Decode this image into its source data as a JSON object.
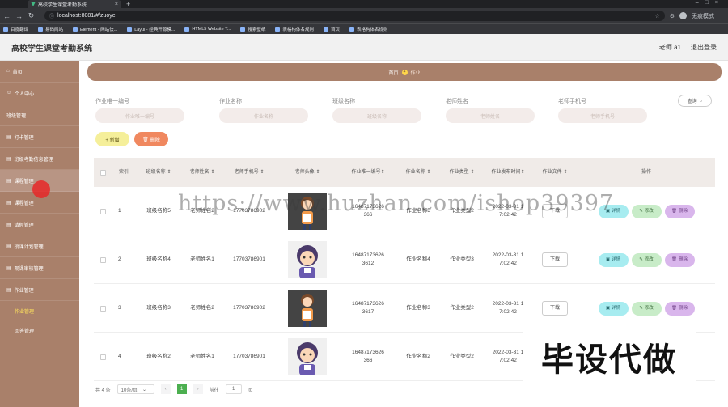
{
  "browser": {
    "tab_title": "高校学生课堂考勤系统",
    "url": "localhost:8081/#/zuoye",
    "profile_label": "无痕模式",
    "bookmarks": [
      "百度翻译",
      "易码网站",
      "Element - 网站快...",
      "Layui - 经典开源模...",
      "HTML5 Website T...",
      "搜索壁纸",
      "表格构体名规则",
      "首页",
      "表格构体名规则"
    ]
  },
  "app": {
    "title": "高校学生课堂考勤系统",
    "user": "老师 a1",
    "logout": "退出登录"
  },
  "sidebar": {
    "items": [
      "首页",
      "个人中心",
      "班级管理",
      "打卡管理",
      "班级考勤信息管理",
      "课程管理",
      "课程管理",
      "请假管理",
      "授课计划管理",
      "观课审核管理",
      "作业管理"
    ],
    "sub_items": [
      "作业管理",
      "回答管理"
    ]
  },
  "breadcrumb": {
    "home": "首页",
    "current": "作业"
  },
  "search": {
    "fields": [
      {
        "label": "作业唯一编号",
        "placeholder": "作业唯一编号"
      },
      {
        "label": "作业名称",
        "placeholder": "作业名称"
      },
      {
        "label": "班级名称",
        "placeholder": "班级名称"
      },
      {
        "label": "老师姓名",
        "placeholder": "老师姓名"
      },
      {
        "label": "老师手机号",
        "placeholder": "老师手机号"
      }
    ],
    "query_label": "查询"
  },
  "actions": {
    "add": "+ 新增",
    "delete": "删除"
  },
  "table": {
    "headers": [
      "索引",
      "班级名称",
      "老师姓名",
      "老师手机号",
      "老师头像",
      "作业唯一编号",
      "作业名称",
      "作业类型",
      "作业发布时间",
      "作业文件",
      "操作"
    ],
    "rows": [
      {
        "idx": "1",
        "class": "班级名称5",
        "teacher": "老师姓名2",
        "phone": "17703786902",
        "avatar": "dark",
        "id": "16487173626\n366",
        "name": "作业名称5",
        "type": "作业类型2",
        "time": "2022-03-31 1\n7:02:42"
      },
      {
        "idx": "2",
        "class": "班级名称4",
        "teacher": "老师姓名1",
        "phone": "17703786901",
        "avatar": "light",
        "id": "16487173626\n3612",
        "name": "作业名称4",
        "type": "作业类型3",
        "time": "2022-03-31 1\n7:02:42"
      },
      {
        "idx": "3",
        "class": "班级名称3",
        "teacher": "老师姓名2",
        "phone": "17703786902",
        "avatar": "dark",
        "id": "16487173626\n3617",
        "name": "作业名称3",
        "type": "作业类型2",
        "time": "2022-03-31 1\n7:02:42"
      },
      {
        "idx": "4",
        "class": "班级名称2",
        "teacher": "老师姓名1",
        "phone": "17703786901",
        "avatar": "light",
        "id": "16487173626\n366",
        "name": "作业名称2",
        "type": "作业类型2",
        "time": "2022-03-31 1\n7:02:42"
      }
    ],
    "download": "下载",
    "op_detail": "详情",
    "op_edit": "修改",
    "op_delete": "删除"
  },
  "pager": {
    "total": "共 4 条",
    "size": "10条/页",
    "page": "1",
    "goto_label": "前往",
    "goto_value": "1",
    "goto_suffix": "页"
  },
  "watermark": "https://www.huzhan.com/ishop39397",
  "promo": "毕设代做"
}
